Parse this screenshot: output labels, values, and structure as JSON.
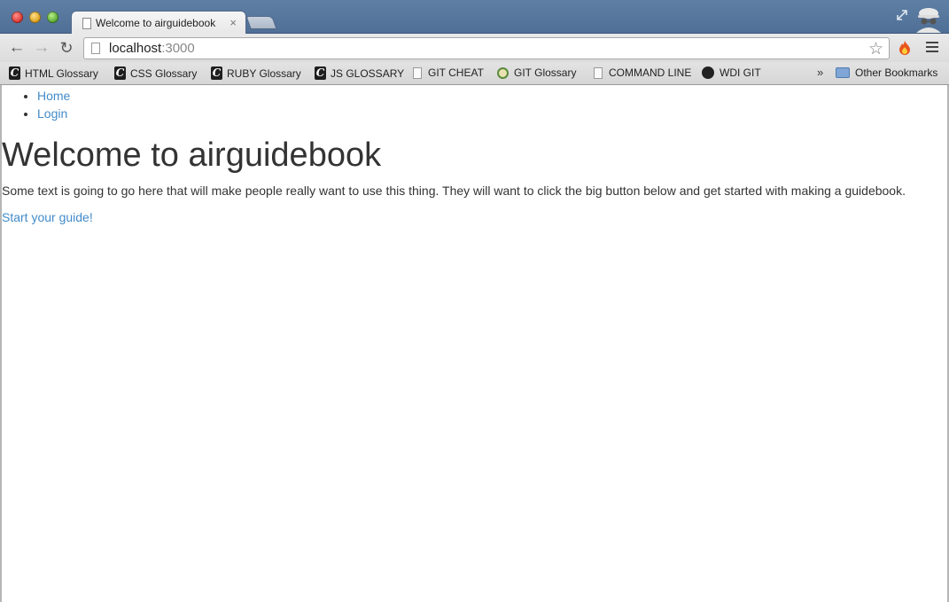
{
  "browser": {
    "tab_title": "Welcome to airguidebook",
    "tab_close": "×",
    "url_host": "localhost",
    "url_port": ":3000",
    "bookmarks": [
      {
        "label": "HTML Glossary",
        "icon": "c-icon"
      },
      {
        "label": "CSS Glossary",
        "icon": "c-icon"
      },
      {
        "label": "RUBY Glossary",
        "icon": "c-icon"
      },
      {
        "label": "JS GLOSSARY",
        "icon": "c-icon"
      },
      {
        "label": "GIT CHEAT",
        "icon": "document-icon"
      },
      {
        "label": "GIT Glossary",
        "icon": "git-glossary-icon"
      },
      {
        "label": "COMMAND LINE",
        "icon": "document-icon"
      },
      {
        "label": "WDI GIT",
        "icon": "github-icon"
      }
    ],
    "overflow": "»",
    "other_bookmarks": "Other Bookmarks",
    "colors": {
      "titlebar": "#5f7fa5",
      "link": "#428bca"
    }
  },
  "page": {
    "nav": [
      {
        "label": "Home"
      },
      {
        "label": "Login"
      }
    ],
    "heading": "Welcome to airguidebook",
    "intro": "Some text is going to go here that will make people really want to use this thing. They will want to click the big button below and get started with making a guidebook.",
    "cta": "Start your guide!"
  }
}
